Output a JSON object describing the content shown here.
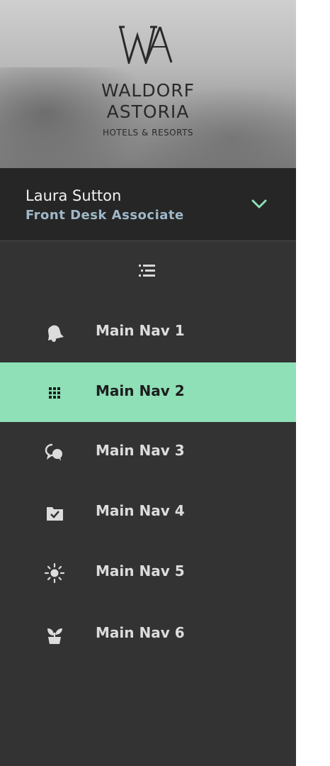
{
  "brand": {
    "name_line1": "WALDORF",
    "name_line2": "ASTORIA",
    "tagline": "HOTELS & RESORTS"
  },
  "user": {
    "name": "Laura Sutton",
    "role": "Front Desk Associate"
  },
  "colors": {
    "sidebar_bg": "#333333",
    "user_block_bg": "#262626",
    "accent": "#8fdfb7",
    "role_text": "#9fb8c8"
  },
  "nav": {
    "items": [
      {
        "label": "Main Nav 1",
        "icon": "bell-icon",
        "active": false
      },
      {
        "label": "Main Nav 2",
        "icon": "grid-icon",
        "active": true
      },
      {
        "label": "Main Nav 3",
        "icon": "chat-bubbles-icon",
        "active": false
      },
      {
        "label": "Main Nav 4",
        "icon": "folder-check-icon",
        "active": false
      },
      {
        "label": "Main Nav 5",
        "icon": "sun-icon",
        "active": false
      },
      {
        "label": "Main Nav 6",
        "icon": "plant-icon",
        "active": false
      }
    ]
  }
}
